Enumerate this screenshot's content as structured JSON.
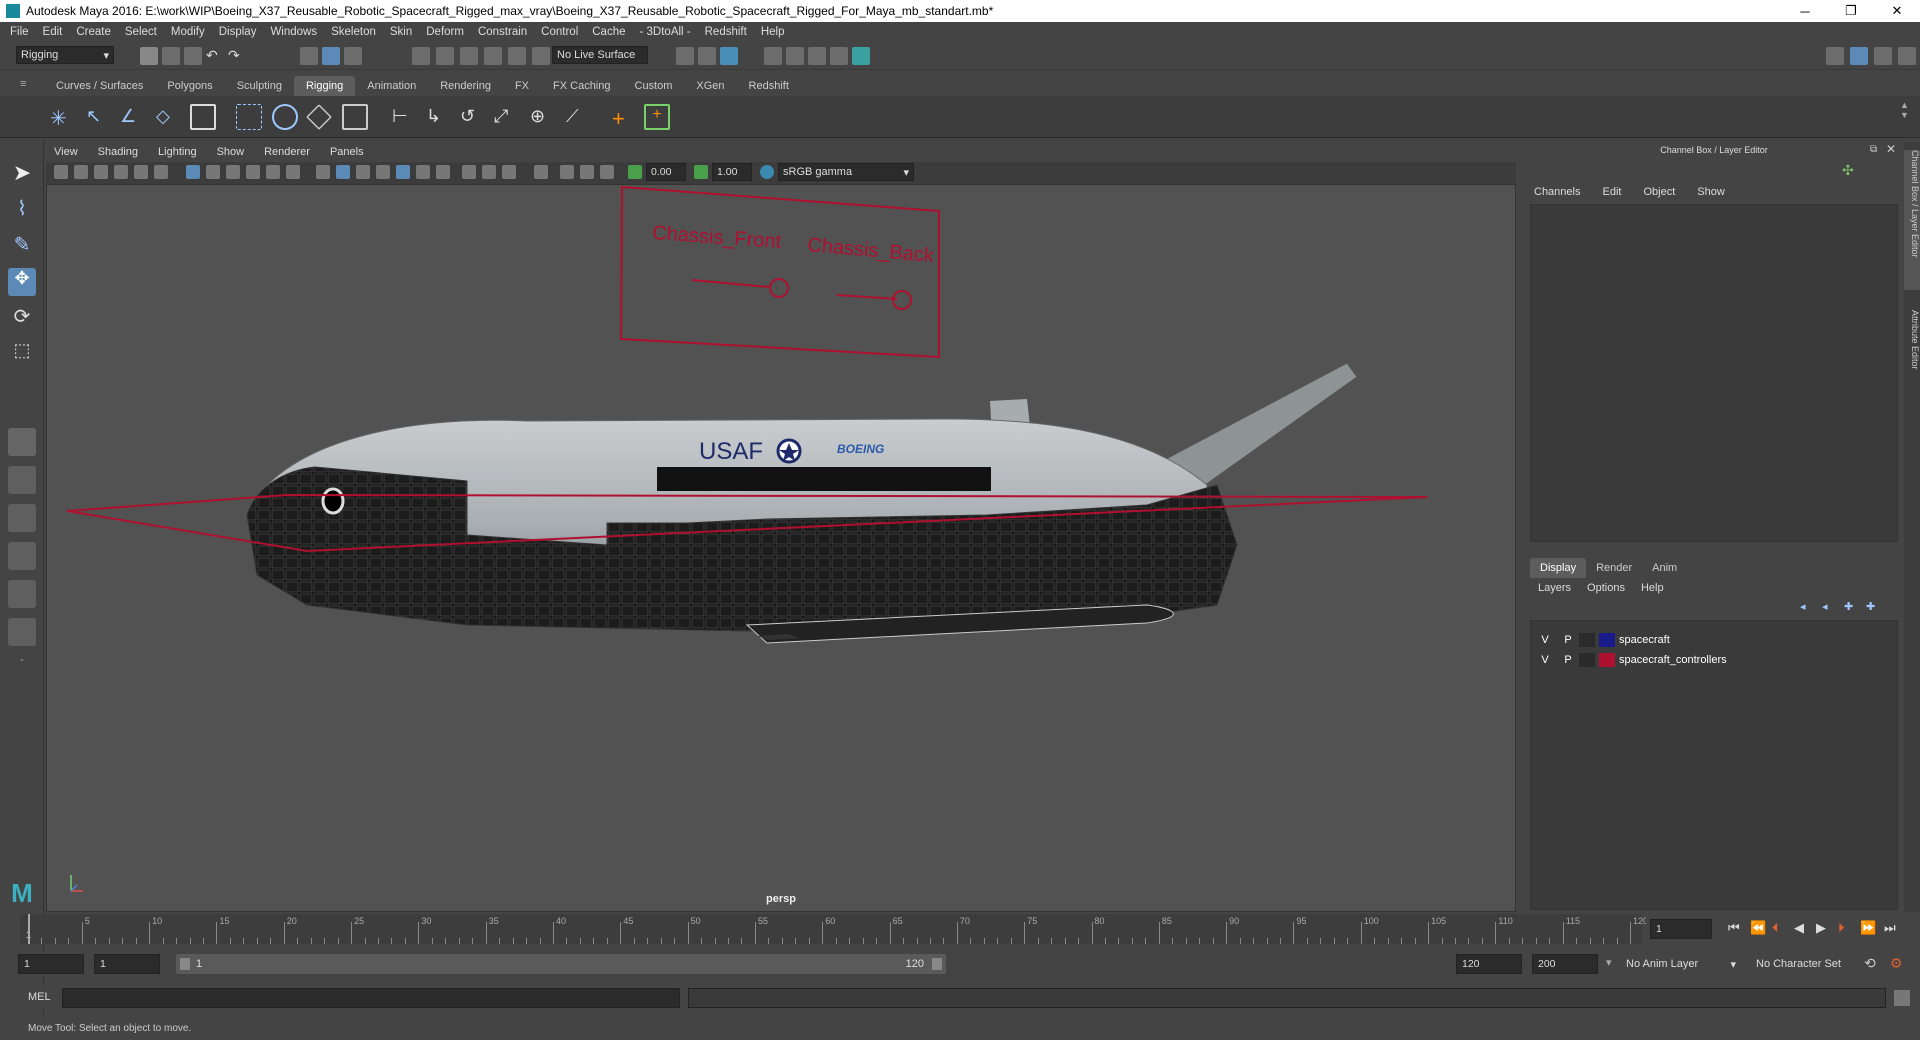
{
  "window": {
    "title": "Autodesk Maya 2016: E:\\work\\WIP\\Boeing_X37_Reusable_Robotic_Spacecraft_Rigged_max_vray\\Boeing_X37_Reusable_Robotic_Spacecraft_Rigged_For_Maya_mb_standart.mb*",
    "minimize": "─",
    "restore": "❐",
    "close": "✕"
  },
  "menubar": [
    "File",
    "Edit",
    "Create",
    "Select",
    "Modify",
    "Display",
    "Windows",
    "Skeleton",
    "Skin",
    "Deform",
    "Constrain",
    "Control",
    "Cache",
    "- 3DtoAll -",
    "Redshift",
    "Help"
  ],
  "statusline": {
    "mode": "Rigging",
    "live_surface": "No Live Surface"
  },
  "shelf_tabs": [
    "Curves / Surfaces",
    "Polygons",
    "Sculpting",
    "Rigging",
    "Animation",
    "Rendering",
    "FX",
    "FX Caching",
    "Custom",
    "XGen",
    "Redshift"
  ],
  "active_shelf": "Rigging",
  "viewport": {
    "menu": [
      "View",
      "Shading",
      "Lighting",
      "Show",
      "Renderer",
      "Panels"
    ],
    "exposure": "0.00",
    "gamma": "1.00",
    "color_space": "sRGB gamma",
    "camera": "persp",
    "scene_labels": {
      "front": "Chassis_Front",
      "back": "Chassis_Back",
      "usaf": "USAF",
      "boeing": "BOEING"
    }
  },
  "channel_box": {
    "title": "Channel Box / Layer Editor",
    "menu": [
      "Channels",
      "Edit",
      "Object",
      "Show"
    ]
  },
  "layer_editor": {
    "tabs": [
      "Display",
      "Render",
      "Anim"
    ],
    "active_tab": "Display",
    "menu": [
      "Layers",
      "Options",
      "Help"
    ],
    "layers": [
      {
        "v": "V",
        "p": "P",
        "name": "spacecraft",
        "color": "#1a1a8a"
      },
      {
        "v": "V",
        "p": "P",
        "name": "spacecraft_controllers",
        "color": "#b01030"
      }
    ]
  },
  "side_tabs": [
    "Channel Box / Layer Editor",
    "Attribute Editor"
  ],
  "timeline": {
    "ticks": [
      "5",
      "10",
      "15",
      "20",
      "25",
      "30",
      "35",
      "40",
      "45",
      "50",
      "55",
      "60",
      "65",
      "70",
      "75",
      "80",
      "85",
      "90",
      "95",
      "100",
      "105",
      "110",
      "115",
      "120"
    ],
    "start_marker": "1",
    "current_frame": "1"
  },
  "range": {
    "start": "1",
    "playback_start": "1",
    "slider_start": "1",
    "slider_end": "120",
    "playback_end": "120",
    "end": "200",
    "anim_layer": "No Anim Layer",
    "character_set": "No Character Set"
  },
  "command_line": {
    "label": "MEL"
  },
  "help_line": "Move Tool: Select an object to move."
}
